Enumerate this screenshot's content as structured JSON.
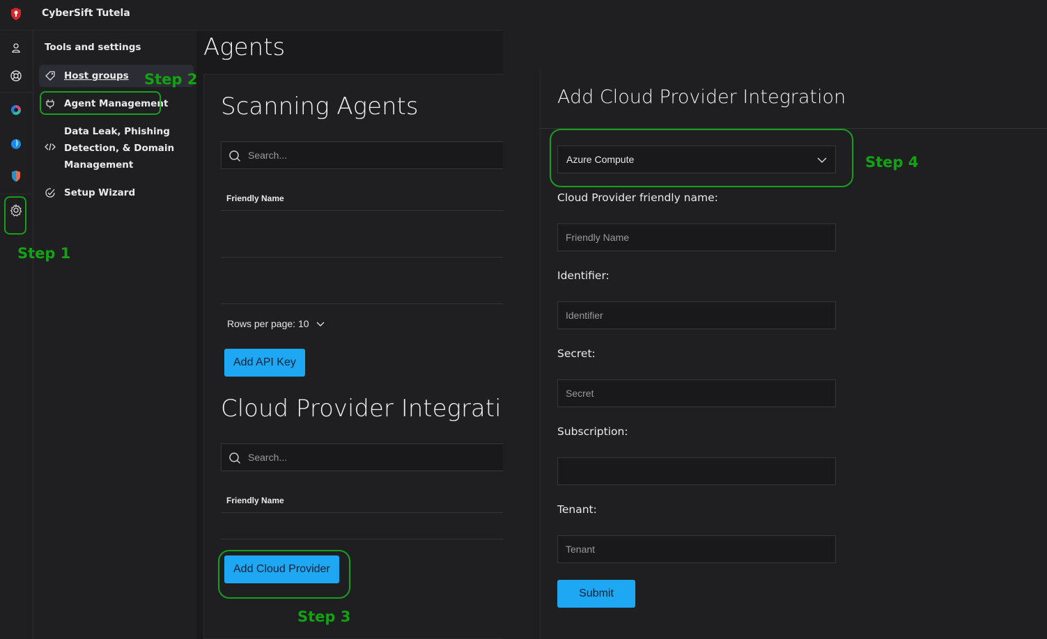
{
  "app": {
    "title": "CyberSift Tutela"
  },
  "rail": {
    "icons": [
      "user-icon",
      "lifebuoy-icon",
      "donut-chart-icon",
      "drop-icon",
      "shield-icon",
      "gear-icon"
    ]
  },
  "tools": {
    "title": "Tools and settings",
    "items": [
      {
        "label": "Host groups",
        "icon": "tag-icon",
        "active": true
      },
      {
        "label": "Agent Management",
        "icon": "plug-icon"
      },
      {
        "label_lines": [
          "Data Leak, Phishing",
          "Detection, & Domain",
          "Management"
        ],
        "icon": "code-icon"
      },
      {
        "label": "Setup Wizard",
        "icon": "check-circle-icon"
      }
    ]
  },
  "page": {
    "title": "Agents"
  },
  "scanning": {
    "title": "Scanning Agents",
    "search_placeholder": "Search...",
    "column": "Friendly Name",
    "rows_per_page": "Rows per page: 10",
    "add_button": "Add API Key"
  },
  "cloud": {
    "title": "Cloud Provider Integration",
    "search_placeholder": "Search...",
    "column": "Friendly Name",
    "add_button": "Add Cloud Provider"
  },
  "modal": {
    "title": "Add Cloud Provider Integration",
    "provider_selected": "Azure Compute",
    "fields": {
      "friendly_label": "Cloud Provider friendly name:",
      "friendly_placeholder": "Friendly Name",
      "identifier_label": "Identifier:",
      "identifier_placeholder": "Identifier",
      "secret_label": "Secret:",
      "secret_placeholder": "Secret",
      "subscription_label": "Subscription:",
      "subscription_placeholder": "",
      "tenant_label": "Tenant:",
      "tenant_placeholder": "Tenant"
    },
    "submit": "Submit"
  },
  "steps": [
    "Step 1",
    "Step 2",
    "Step 3",
    "Step 4"
  ],
  "colors": {
    "accent": "#1ea7f2",
    "annotation": "#17a01c",
    "logo": "#d9262b"
  }
}
